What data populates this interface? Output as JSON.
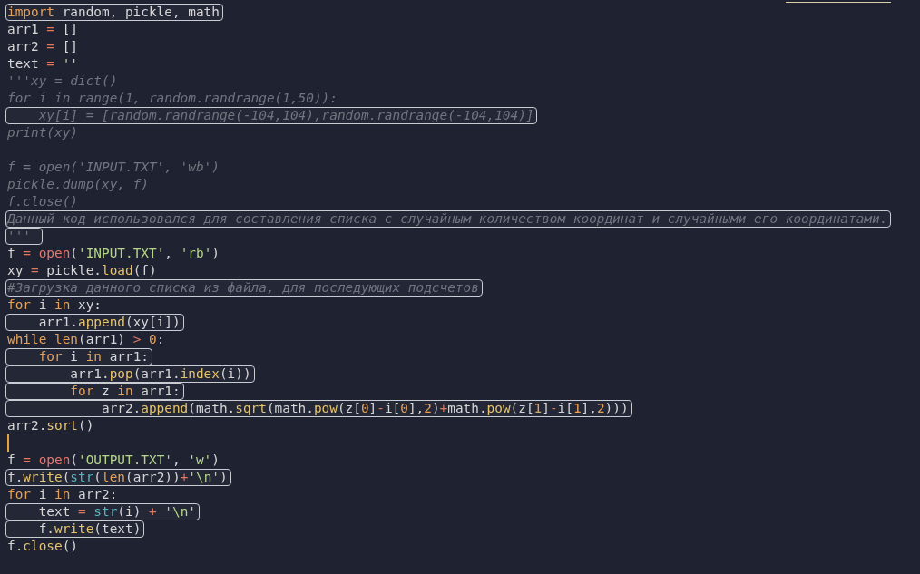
{
  "lines": [
    {
      "boxed": true,
      "cursor": false,
      "tokens": [
        {
          "text": "import",
          "kind": "kw"
        },
        {
          "text": " random, pickle, math",
          "kind": "pl"
        }
      ]
    },
    {
      "boxed": false,
      "cursor": false,
      "tokens": [
        {
          "text": "arr1 ",
          "kind": "pl"
        },
        {
          "text": "=",
          "kind": "op"
        },
        {
          "text": " []",
          "kind": "pl"
        }
      ]
    },
    {
      "boxed": false,
      "cursor": false,
      "tokens": [
        {
          "text": "arr2 ",
          "kind": "pl"
        },
        {
          "text": "=",
          "kind": "op"
        },
        {
          "text": " []",
          "kind": "pl"
        }
      ]
    },
    {
      "boxed": false,
      "cursor": false,
      "tokens": [
        {
          "text": "text ",
          "kind": "pl"
        },
        {
          "text": "=",
          "kind": "op"
        },
        {
          "text": " ''",
          "kind": "str"
        }
      ]
    },
    {
      "boxed": false,
      "cursor": false,
      "tokens": [
        {
          "text": "'''xy = dict()",
          "kind": "cm"
        }
      ]
    },
    {
      "boxed": false,
      "cursor": false,
      "tokens": [
        {
          "text": "for i in range(1, random.randrange(1,50)):",
          "kind": "cm"
        }
      ]
    },
    {
      "boxed": true,
      "cursor": false,
      "tokens": [
        {
          "text": "    xy[i] = [random.randrange(-104,104),random.randrange(-104,104)]",
          "kind": "cm"
        }
      ]
    },
    {
      "boxed": false,
      "cursor": false,
      "tokens": [
        {
          "text": "print(xy)",
          "kind": "cm"
        }
      ]
    },
    {
      "boxed": false,
      "cursor": false
    },
    {
      "boxed": false,
      "cursor": false,
      "tokens": [
        {
          "text": "f = open('INPUT.TXT', 'wb')",
          "kind": "cm"
        }
      ]
    },
    {
      "boxed": false,
      "cursor": false,
      "tokens": [
        {
          "text": "pickle.dump(xy, f)",
          "kind": "cm"
        }
      ]
    },
    {
      "boxed": false,
      "cursor": false,
      "tokens": [
        {
          "text": "f.close()",
          "kind": "cm"
        }
      ]
    },
    {
      "boxed": true,
      "cursor": false,
      "tokens": [
        {
          "text": "Данный код использовался для составления списка с случайным количеством координат и случайными его координатами.",
          "kind": "cm"
        }
      ]
    },
    {
      "boxed": true,
      "cursor": false,
      "tokens": [
        {
          "text": "''' ",
          "kind": "cm"
        }
      ]
    },
    {
      "boxed": false,
      "cursor": false,
      "tokens": [
        {
          "text": "f ",
          "kind": "pl"
        },
        {
          "text": "=",
          "kind": "op"
        },
        {
          "text": " open",
          "kind": "call"
        },
        {
          "text": "(",
          "kind": "pl"
        },
        {
          "text": "'INPUT.TXT'",
          "kind": "str"
        },
        {
          "text": ", ",
          "kind": "pl"
        },
        {
          "text": "'rb'",
          "kind": "str"
        },
        {
          "text": ")",
          "kind": "pl"
        }
      ]
    },
    {
      "boxed": false,
      "cursor": false,
      "tokens": [
        {
          "text": "xy ",
          "kind": "pl"
        },
        {
          "text": "=",
          "kind": "op"
        },
        {
          "text": " pickle.",
          "kind": "pl"
        },
        {
          "text": "load",
          "kind": "fn"
        },
        {
          "text": "(f)",
          "kind": "pl"
        }
      ]
    },
    {
      "boxed": true,
      "cursor": false,
      "tokens": [
        {
          "text": "#Загрузка данного списка из файла, для последующих подсчетов",
          "kind": "cm"
        }
      ]
    },
    {
      "boxed": false,
      "cursor": false,
      "tokens": [
        {
          "text": "for",
          "kind": "kw"
        },
        {
          "text": " i ",
          "kind": "pl"
        },
        {
          "text": "in",
          "kind": "kw"
        },
        {
          "text": " xy:",
          "kind": "pl"
        }
      ]
    },
    {
      "boxed": true,
      "cursor": false,
      "tokens": [
        {
          "text": "    arr1.",
          "kind": "pl"
        },
        {
          "text": "append",
          "kind": "fn"
        },
        {
          "text": "(xy[i])",
          "kind": "pl"
        }
      ]
    },
    {
      "boxed": false,
      "cursor": false,
      "tokens": [
        {
          "text": "while",
          "kind": "kw"
        },
        {
          "text": " len",
          "kind": "kw"
        },
        {
          "text": "(arr1) ",
          "kind": "pl"
        },
        {
          "text": ">",
          "kind": "op"
        },
        {
          "text": " 0",
          "kind": "num"
        },
        {
          "text": ":",
          "kind": "pl"
        }
      ]
    },
    {
      "boxed": true,
      "cursor": false,
      "tokens": [
        {
          "text": "    for",
          "kind": "kw"
        },
        {
          "text": " i ",
          "kind": "pl"
        },
        {
          "text": "in",
          "kind": "kw"
        },
        {
          "text": " arr1:",
          "kind": "pl"
        }
      ]
    },
    {
      "boxed": true,
      "cursor": false,
      "tokens": [
        {
          "text": "        arr1.",
          "kind": "pl"
        },
        {
          "text": "pop",
          "kind": "fn"
        },
        {
          "text": "(arr1.",
          "kind": "pl"
        },
        {
          "text": "index",
          "kind": "fn"
        },
        {
          "text": "(i))",
          "kind": "pl"
        }
      ]
    },
    {
      "boxed": true,
      "cursor": false,
      "tokens": [
        {
          "text": "        for",
          "kind": "kw"
        },
        {
          "text": " z ",
          "kind": "pl"
        },
        {
          "text": "in",
          "kind": "kw"
        },
        {
          "text": " arr1:",
          "kind": "pl"
        }
      ]
    },
    {
      "boxed": true,
      "cursor": false,
      "tokens": [
        {
          "text": "            arr2.",
          "kind": "pl"
        },
        {
          "text": "append",
          "kind": "fn"
        },
        {
          "text": "(math.",
          "kind": "pl"
        },
        {
          "text": "sqrt",
          "kind": "fn"
        },
        {
          "text": "(math.",
          "kind": "pl"
        },
        {
          "text": "pow",
          "kind": "fn"
        },
        {
          "text": "(z[",
          "kind": "pl"
        },
        {
          "text": "0",
          "kind": "num"
        },
        {
          "text": "]",
          "kind": "pl"
        },
        {
          "text": "-",
          "kind": "op"
        },
        {
          "text": "i[",
          "kind": "pl"
        },
        {
          "text": "0",
          "kind": "num"
        },
        {
          "text": "],",
          "kind": "pl"
        },
        {
          "text": "2",
          "kind": "num"
        },
        {
          "text": ")",
          "kind": "pl"
        },
        {
          "text": "+",
          "kind": "op"
        },
        {
          "text": "math.",
          "kind": "pl"
        },
        {
          "text": "pow",
          "kind": "fn"
        },
        {
          "text": "(z[",
          "kind": "pl"
        },
        {
          "text": "1",
          "kind": "num"
        },
        {
          "text": "]",
          "kind": "pl"
        },
        {
          "text": "-",
          "kind": "op"
        },
        {
          "text": "i[",
          "kind": "pl"
        },
        {
          "text": "1",
          "kind": "num"
        },
        {
          "text": "],",
          "kind": "pl"
        },
        {
          "text": "2",
          "kind": "num"
        },
        {
          "text": ")))",
          "kind": "pl"
        }
      ]
    },
    {
      "boxed": false,
      "cursor": false,
      "tokens": [
        {
          "text": "arr2.",
          "kind": "pl"
        },
        {
          "text": "sort",
          "kind": "fn"
        },
        {
          "text": "()",
          "kind": "pl"
        }
      ]
    },
    {
      "boxed": false,
      "cursor": true
    },
    {
      "boxed": false,
      "cursor": false,
      "tokens": [
        {
          "text": "f ",
          "kind": "pl"
        },
        {
          "text": "=",
          "kind": "op"
        },
        {
          "text": " open",
          "kind": "call"
        },
        {
          "text": "(",
          "kind": "pl"
        },
        {
          "text": "'OUTPUT.TXT'",
          "kind": "str"
        },
        {
          "text": ", ",
          "kind": "pl"
        },
        {
          "text": "'w'",
          "kind": "str"
        },
        {
          "text": ")",
          "kind": "pl"
        }
      ]
    },
    {
      "boxed": true,
      "cursor": false,
      "tokens": [
        {
          "text": "f.",
          "kind": "pl"
        },
        {
          "text": "write",
          "kind": "fn"
        },
        {
          "text": "(",
          "kind": "pl"
        },
        {
          "text": "str",
          "kind": "bi"
        },
        {
          "text": "(",
          "kind": "pl"
        },
        {
          "text": "len",
          "kind": "kw"
        },
        {
          "text": "(arr2))",
          "kind": "pl"
        },
        {
          "text": "+",
          "kind": "op"
        },
        {
          "text": "'\\n'",
          "kind": "str"
        },
        {
          "text": ")",
          "kind": "pl"
        }
      ]
    },
    {
      "boxed": false,
      "cursor": false,
      "tokens": [
        {
          "text": "for",
          "kind": "kw"
        },
        {
          "text": " i ",
          "kind": "pl"
        },
        {
          "text": "in",
          "kind": "kw"
        },
        {
          "text": " arr2:",
          "kind": "pl"
        }
      ]
    },
    {
      "boxed": true,
      "cursor": false,
      "tokens": [
        {
          "text": "    text ",
          "kind": "pl"
        },
        {
          "text": "=",
          "kind": "op"
        },
        {
          "text": " str",
          "kind": "bi"
        },
        {
          "text": "(i) ",
          "kind": "pl"
        },
        {
          "text": "+",
          "kind": "op"
        },
        {
          "text": " '\\n'",
          "kind": "str"
        }
      ]
    },
    {
      "boxed": true,
      "cursor": false,
      "tokens": [
        {
          "text": "    f.",
          "kind": "pl"
        },
        {
          "text": "write",
          "kind": "fn"
        },
        {
          "text": "(text)",
          "kind": "pl"
        }
      ]
    },
    {
      "boxed": false,
      "cursor": false,
      "tokens": [
        {
          "text": "f.",
          "kind": "pl"
        },
        {
          "text": "close",
          "kind": "fn"
        },
        {
          "text": "()",
          "kind": "pl"
        }
      ]
    }
  ]
}
